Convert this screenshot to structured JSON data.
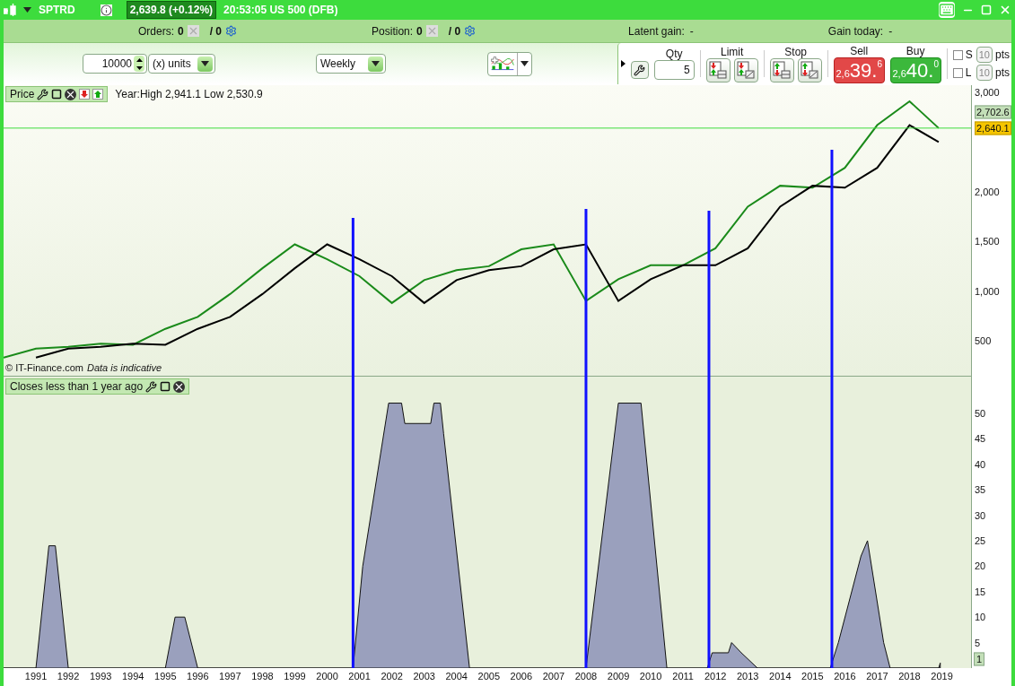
{
  "title_bar": {
    "symbol": "SPTRD",
    "price": "2,639.8 (+0.12%)",
    "info": "20:53:05 US 500 (DFB)"
  },
  "summary": {
    "orders": {
      "label": "Orders:",
      "count": "0",
      "total": "/ 0"
    },
    "position": {
      "label": "Position:",
      "count": "0",
      "total": "/ 0"
    },
    "latent_gain": {
      "label": "Latent gain:",
      "value": "-"
    },
    "gain_today": {
      "label": "Gain today:",
      "value": "-"
    }
  },
  "toolbar": {
    "quantity": "10000",
    "unit": "(x) units",
    "period": "Weekly"
  },
  "trade": {
    "qty_label": "Qty",
    "qty": "5",
    "limit_label": "Limit",
    "stop_label": "Stop",
    "sell": {
      "label": "Sell",
      "prefix": "2,6",
      "big": "39.",
      "sup": "6"
    },
    "buy": {
      "label": "Buy",
      "prefix": "2,6",
      "big": "40.",
      "sup": "0"
    },
    "stops": [
      {
        "label": "S",
        "value": "10",
        "unit": "pts",
        "checked": false,
        "disabled": true
      },
      {
        "label": "L",
        "value": "10",
        "unit": "pts",
        "checked": false,
        "disabled": true
      }
    ]
  },
  "price_panel": {
    "title": "Price",
    "range": "Year:High 2,941.1 Low 2,530.9",
    "credit": "© IT-Finance.com",
    "note": "Data is indicative",
    "markers": [
      {
        "label": "2,702.6",
        "kind": "level"
      },
      {
        "label": "2,640.1",
        "kind": "current"
      }
    ],
    "chart_data": {
      "type": "line",
      "xlim": [
        1990,
        2019.9
      ],
      "ylim": [
        139,
        3072
      ],
      "x": [
        1990,
        1991,
        1992,
        1993,
        1994,
        1995,
        1996,
        1997,
        1998,
        1999,
        2000,
        2001,
        2002,
        2003,
        2004,
        2005,
        2006,
        2007,
        2008,
        2009,
        2010,
        2011,
        2012,
        2013,
        2014,
        2015,
        2016,
        2017,
        2018,
        2018.9
      ],
      "series": [
        {
          "color": "#1a8a1a",
          "values": [
            330,
            420,
            440,
            470,
            460,
            620,
            740,
            970,
            1230,
            1470,
            1320,
            1150,
            880,
            1110,
            1210,
            1250,
            1420,
            1470,
            900,
            1120,
            1260,
            1260,
            1430,
            1850,
            2060,
            2040,
            2240,
            2670,
            2910,
            2640
          ]
        },
        {
          "color": "#000000",
          "values": [
            null,
            330,
            420,
            440,
            470,
            460,
            620,
            740,
            970,
            1230,
            1470,
            1320,
            1150,
            880,
            1110,
            1210,
            1250,
            1420,
            1470,
            900,
            1120,
            1260,
            1260,
            1430,
            1850,
            2060,
            2040,
            2240,
            2670,
            2500
          ]
        }
      ],
      "yticks": [
        {
          "value": 3000,
          "label": "3,000"
        },
        {
          "value": 2000,
          "label": "2,000"
        },
        {
          "value": 1500,
          "label": "1,500"
        },
        {
          "value": 1000,
          "label": "1,000"
        },
        {
          "value": 500,
          "label": "500"
        }
      ]
    }
  },
  "lower_panel": {
    "marker": "1",
    "chart_data": {
      "type": "area",
      "title": "Closes less than 1 year ago",
      "xlim": [
        1990,
        2019.9
      ],
      "ylim": [
        0,
        57.2
      ],
      "x": [
        1990,
        1991,
        1991.4,
        1991.6,
        1992,
        1995,
        1995.3,
        1995.6,
        1996,
        2000.8,
        2001.1,
        2001.9,
        2002.3,
        2002.4,
        2003.2,
        2003.3,
        2003.5,
        2003.6,
        2004.4,
        2008,
        2009,
        2009.7,
        2010.5,
        2011.75,
        2011.9,
        2012.4,
        2012.5,
        2012.8,
        2013.3,
        2015.55,
        2015.8,
        2016.5,
        2016.7,
        2017.2,
        2017.4,
        2018.9,
        2018.95
      ],
      "series": [
        {
          "color": "#9aa0bd",
          "values": [
            0,
            0,
            24,
            24,
            0,
            0,
            10,
            10,
            0,
            0,
            20,
            52,
            52,
            48,
            48,
            52,
            52,
            46,
            0,
            0,
            52,
            52,
            0,
            0,
            3,
            3,
            5,
            3,
            0,
            0,
            5,
            22,
            25,
            5,
            0,
            0,
            1
          ]
        }
      ],
      "yticks": [
        50,
        45,
        40,
        35,
        30,
        25,
        20,
        15,
        10,
        5
      ],
      "xticks": [
        1991,
        1992,
        1993,
        1994,
        1995,
        1996,
        1997,
        1998,
        1999,
        2000,
        2001,
        2002,
        2003,
        2004,
        2005,
        2006,
        2007,
        2008,
        2009,
        2010,
        2011,
        2012,
        2013,
        2014,
        2015,
        2016,
        2017,
        2018,
        2019
      ]
    }
  }
}
